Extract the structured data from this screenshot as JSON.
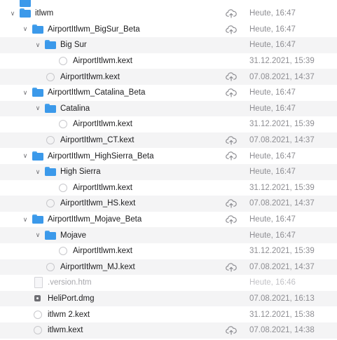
{
  "rows": [
    {
      "name": "",
      "date": "",
      "indent": 0,
      "chevron": "",
      "icon": "folder",
      "cloud": false,
      "alt": false,
      "partial": true
    },
    {
      "name": "itlwm",
      "date": "Heute, 16:47",
      "indent": 0,
      "chevron": "down",
      "icon": "folder",
      "cloud": true,
      "alt": false
    },
    {
      "name": "AirportItlwm_BigSur_Beta",
      "date": "Heute, 16:47",
      "indent": 1,
      "chevron": "down",
      "icon": "folder",
      "cloud": true,
      "alt": false
    },
    {
      "name": "Big Sur",
      "date": "Heute, 16:47",
      "indent": 2,
      "chevron": "down",
      "icon": "folder",
      "cloud": false,
      "alt": true
    },
    {
      "name": "AirportItlwm.kext",
      "date": "31.12.2021, 15:39",
      "indent": 3,
      "chevron": "",
      "icon": "kext",
      "cloud": false,
      "alt": false
    },
    {
      "name": "AirportItlwm.kext",
      "date": "07.08.2021, 14:37",
      "indent": 2,
      "chevron": "",
      "icon": "kext",
      "cloud": true,
      "alt": true
    },
    {
      "name": "AirportItlwm_Catalina_Beta",
      "date": "Heute, 16:47",
      "indent": 1,
      "chevron": "down",
      "icon": "folder",
      "cloud": true,
      "alt": false
    },
    {
      "name": "Catalina",
      "date": "Heute, 16:47",
      "indent": 2,
      "chevron": "down",
      "icon": "folder",
      "cloud": false,
      "alt": true
    },
    {
      "name": "AirportItlwm.kext",
      "date": "31.12.2021, 15:39",
      "indent": 3,
      "chevron": "",
      "icon": "kext",
      "cloud": false,
      "alt": false
    },
    {
      "name": "AirportItlwm_CT.kext",
      "date": "07.08.2021, 14:37",
      "indent": 2,
      "chevron": "",
      "icon": "kext",
      "cloud": true,
      "alt": true
    },
    {
      "name": "AirportItlwm_HighSierra_Beta",
      "date": "Heute, 16:47",
      "indent": 1,
      "chevron": "down",
      "icon": "folder",
      "cloud": true,
      "alt": false
    },
    {
      "name": "High Sierra",
      "date": "Heute, 16:47",
      "indent": 2,
      "chevron": "down",
      "icon": "folder",
      "cloud": false,
      "alt": true
    },
    {
      "name": "AirportItlwm.kext",
      "date": "31.12.2021, 15:39",
      "indent": 3,
      "chevron": "",
      "icon": "kext",
      "cloud": false,
      "alt": false
    },
    {
      "name": "AirportItlwm_HS.kext",
      "date": "07.08.2021, 14:37",
      "indent": 2,
      "chevron": "",
      "icon": "kext",
      "cloud": true,
      "alt": true
    },
    {
      "name": "AirportItlwm_Mojave_Beta",
      "date": "Heute, 16:47",
      "indent": 1,
      "chevron": "down",
      "icon": "folder",
      "cloud": true,
      "alt": false
    },
    {
      "name": "Mojave",
      "date": "Heute, 16:47",
      "indent": 2,
      "chevron": "down",
      "icon": "folder",
      "cloud": false,
      "alt": true
    },
    {
      "name": "AirportItlwm.kext",
      "date": "31.12.2021, 15:39",
      "indent": 3,
      "chevron": "",
      "icon": "kext",
      "cloud": false,
      "alt": false
    },
    {
      "name": "AirportItlwm_MJ.kext",
      "date": "07.08.2021, 14:37",
      "indent": 2,
      "chevron": "",
      "icon": "kext",
      "cloud": true,
      "alt": true
    },
    {
      "name": ".version.htm",
      "date": "Heute, 16:46",
      "indent": 1,
      "chevron": "",
      "icon": "doc",
      "cloud": false,
      "alt": false,
      "dim": true
    },
    {
      "name": "HeliPort.dmg",
      "date": "07.08.2021, 16:13",
      "indent": 1,
      "chevron": "",
      "icon": "dmg",
      "cloud": false,
      "alt": true
    },
    {
      "name": "itlwm 2.kext",
      "date": "31.12.2021, 15:38",
      "indent": 1,
      "chevron": "",
      "icon": "kext",
      "cloud": false,
      "alt": false
    },
    {
      "name": "itlwm.kext",
      "date": "07.08.2021, 14:38",
      "indent": 1,
      "chevron": "",
      "icon": "kext",
      "cloud": true,
      "alt": true
    }
  ]
}
